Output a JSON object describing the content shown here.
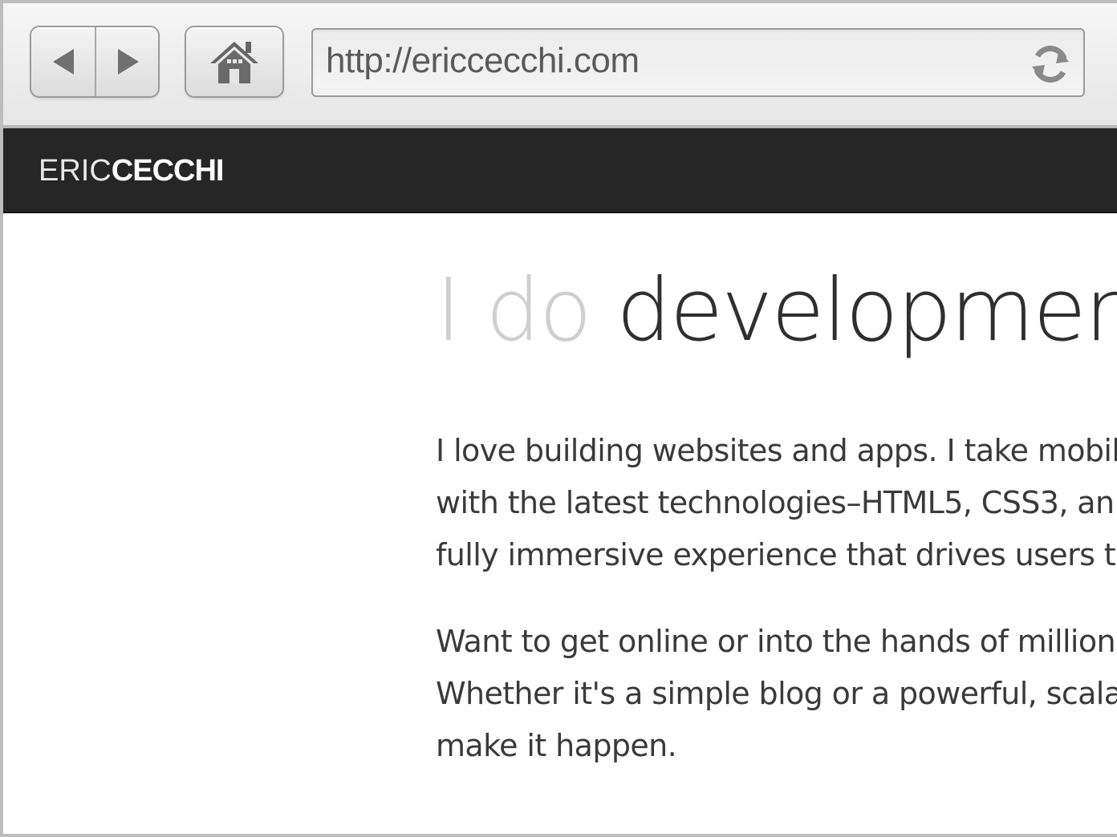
{
  "browser": {
    "url": "http://ericcecchi.com",
    "back_icon": "back-arrow-icon",
    "forward_icon": "forward-arrow-icon",
    "home_icon": "home-icon",
    "reload_icon": "reload-icon"
  },
  "site": {
    "logo_light": "ERIC",
    "logo_bold": "CECCHI",
    "headline_prefix": "I do",
    "headline_word": "development",
    "paragraph1": [
      "I love building websites and apps. I take mobil",
      "with the latest technologies–HTML5, CSS3, an",
      "fully immersive experience that drives users to"
    ],
    "paragraph2": [
      "Want to get online or into the hands of million",
      "Whether it's a simple blog or a powerful, scala",
      "make it happen."
    ]
  },
  "colors": {
    "header_bg": "#262626",
    "headline_prefix": "#cfcfcf",
    "headline_word": "#2f2f2f",
    "body_text": "#3a3a3a"
  }
}
